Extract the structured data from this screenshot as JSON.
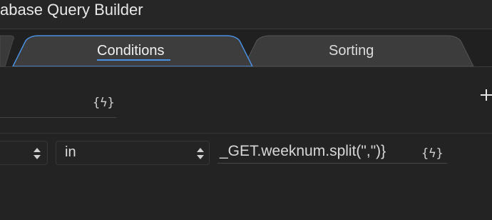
{
  "window": {
    "title": "abase Query Builder"
  },
  "tabs": [
    {
      "label": "Conditions",
      "active": true
    },
    {
      "label": "Sorting",
      "active": false
    }
  ],
  "condition_row": {
    "operator": "in",
    "value": "_GET.weeknum.split(\",\")}"
  },
  "icons": {
    "dynamic_data": "{ϟ}",
    "add": "plus-icon",
    "select_arrows": "updown-arrows-icon"
  },
  "colors": {
    "background": "#232323",
    "accent": "#4a90e2",
    "text": "#d9d9d9"
  }
}
